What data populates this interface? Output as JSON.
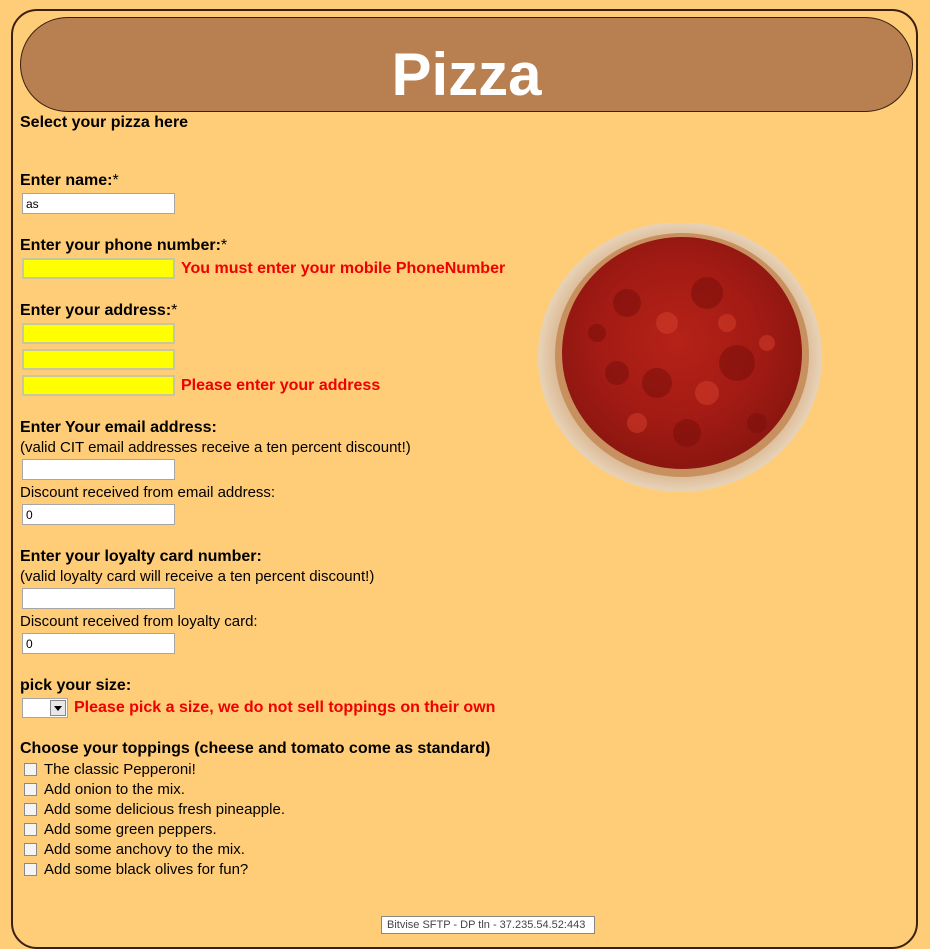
{
  "header": {
    "title": "Pizza"
  },
  "intro": "Select your pizza here",
  "name": {
    "label": "Enter name:",
    "required": "*",
    "value": "as"
  },
  "phone": {
    "label": "Enter your phone number:",
    "required": "*",
    "value": "",
    "error": "You must enter your mobile PhoneNumber"
  },
  "address": {
    "label": "Enter your address:",
    "required": "*",
    "line1": "",
    "line2": "",
    "line3": "",
    "error": "Please enter your address"
  },
  "email": {
    "label": "Enter Your email address:",
    "note": "(valid CIT email addresses receive a ten percent discount!)",
    "value": "",
    "discount_label": "Discount received from email address:",
    "discount_value": "0"
  },
  "loyalty": {
    "label": "Enter your loyalty card number:",
    "note": "(valid loyalty card will receive a ten percent discount!)",
    "value": "",
    "discount_label": "Discount received from loyalty card:",
    "discount_value": "0"
  },
  "size": {
    "label": "pick your size:",
    "selected": "",
    "error": "Please pick a size, we do not sell toppings on their own"
  },
  "toppings": {
    "label": "Choose your toppings (cheese and tomato come as standard)",
    "items": [
      {
        "label": "The classic Pepperoni!",
        "checked": false
      },
      {
        "label": "Add onion to the mix.",
        "checked": false
      },
      {
        "label": "Add some delicious fresh pineapple.",
        "checked": false
      },
      {
        "label": "Add some green peppers.",
        "checked": false
      },
      {
        "label": "Add some anchovy to the mix.",
        "checked": false
      },
      {
        "label": "Add some black olives for fun?",
        "checked": false
      }
    ]
  },
  "status_tip": "Bitvise SFTP - DP tln - 37.235.54.52:443",
  "colors": {
    "page_bg": "#ffcc77",
    "header_bg": "#b88050",
    "error": "#ee0000",
    "invalid_field": "#ffff00"
  },
  "icons": {
    "pizza": "pizza-image",
    "dropdown": "chevron-down-icon"
  }
}
